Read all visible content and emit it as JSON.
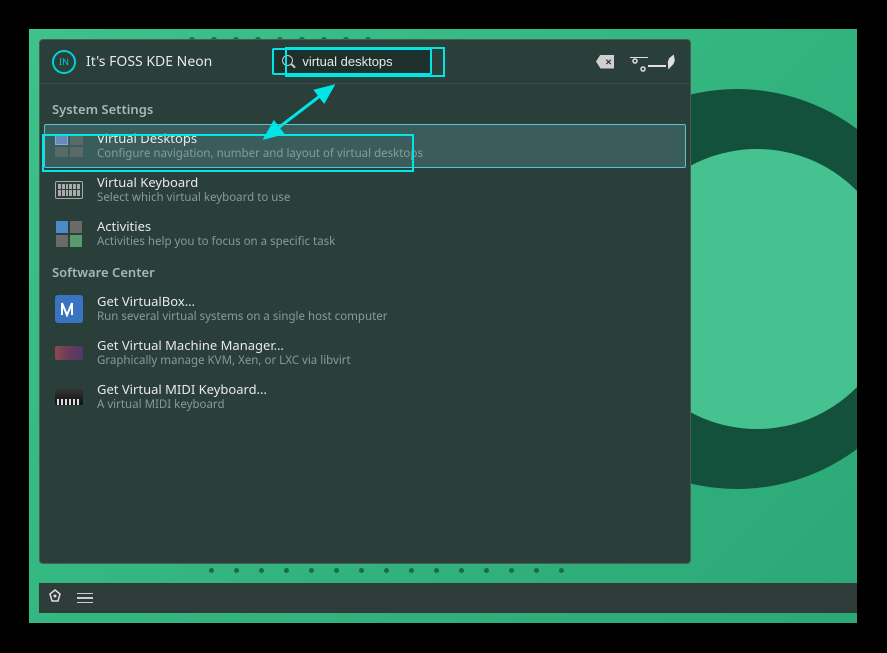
{
  "header": {
    "title": "It's FOSS KDE Neon",
    "logo_text": "IN",
    "search_value": "virtual desktops"
  },
  "sections": [
    {
      "name": "System Settings",
      "items": [
        {
          "title": "Virtual Desktops",
          "desc": "Configure navigation, number and layout of virtual desktops",
          "selected": true,
          "icon": "vdesk"
        },
        {
          "title": "Virtual Keyboard",
          "desc": "Select which virtual keyboard to use",
          "selected": false,
          "icon": "vkbd"
        },
        {
          "title": "Activities",
          "desc": "Activities help you to focus on a specific task",
          "selected": false,
          "icon": "act"
        }
      ]
    },
    {
      "name": "Software Center",
      "items": [
        {
          "title": "Get VirtualBox…",
          "desc": "Run several virtual systems on a single host computer",
          "selected": false,
          "icon": "vbox"
        },
        {
          "title": "Get Virtual Machine Manager…",
          "desc": "Graphically manage KVM, Xen, or LXC via libvirt",
          "selected": false,
          "icon": "vmm"
        },
        {
          "title": "Get Virtual MIDI Keyboard…",
          "desc": "A virtual MIDI keyboard",
          "selected": false,
          "icon": "midi"
        }
      ]
    }
  ]
}
